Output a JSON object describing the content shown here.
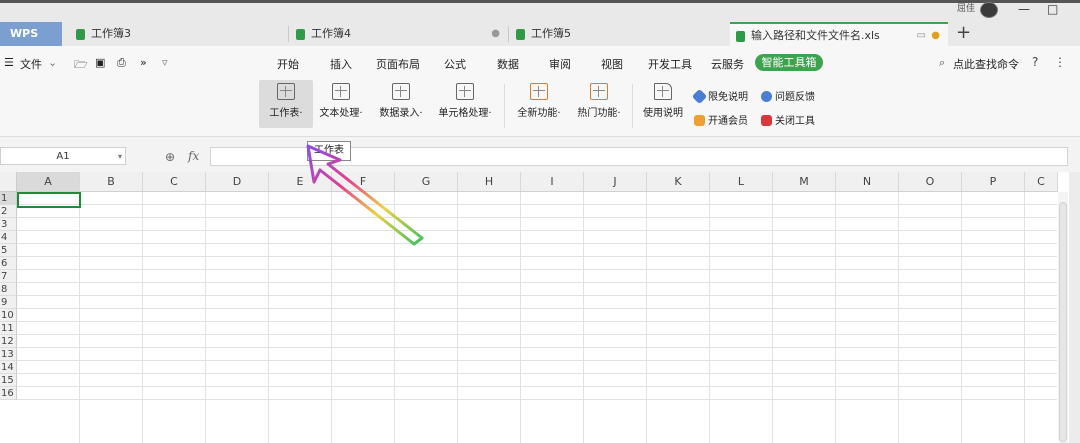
{
  "window": {
    "user_name": "屈佳",
    "minimize": "—",
    "restore": "□"
  },
  "tabs": [
    {
      "label": "WPS"
    },
    {
      "label": "工作簿3"
    },
    {
      "label": "工作簿4"
    },
    {
      "label": "工作簿5"
    },
    {
      "label": "输入路径和文件文件名.xls"
    }
  ],
  "tab_close": "●",
  "new_tab": "+",
  "quick_access": {
    "hamburger": "☰",
    "file": "文件",
    "more": "»"
  },
  "menu": {
    "items": [
      "开始",
      "插入",
      "页面布局",
      "公式",
      "数据",
      "审阅",
      "视图",
      "开发工具",
      "云服务"
    ],
    "active": "智能工具箱",
    "search": "点此查找命令",
    "help": "?",
    "more": "⋮"
  },
  "ribbon": {
    "buttons": [
      {
        "label": "工作表·"
      },
      {
        "label": "文本处理·"
      },
      {
        "label": "数据录入·"
      },
      {
        "label": "单元格处理·"
      },
      {
        "label": "全新功能·"
      },
      {
        "label": "热门功能·"
      },
      {
        "label": "使用说明"
      }
    ],
    "small": [
      {
        "label": "限免说明"
      },
      {
        "label": "问题反馈"
      },
      {
        "label": "开通会员"
      },
      {
        "label": "关闭工具"
      }
    ]
  },
  "formula_bar": {
    "cell_ref": "A1",
    "fx": "fx",
    "value": ""
  },
  "tooltip": "工作表",
  "sheet": {
    "columns": [
      "A",
      "B",
      "C",
      "D",
      "E",
      "F",
      "G",
      "H",
      "I",
      "J",
      "K",
      "L",
      "M",
      "N",
      "O",
      "P",
      "C"
    ],
    "rows": [
      "1",
      "2",
      "3",
      "4",
      "5",
      "6",
      "7",
      "8",
      "9",
      "10",
      "11",
      "12",
      "13",
      "14",
      "15",
      "16"
    ],
    "active_cell": "A1"
  },
  "colors": {
    "accent": "#3da34f",
    "wps_tab": "#7a9fd0",
    "selection": "#1e8a3a"
  }
}
